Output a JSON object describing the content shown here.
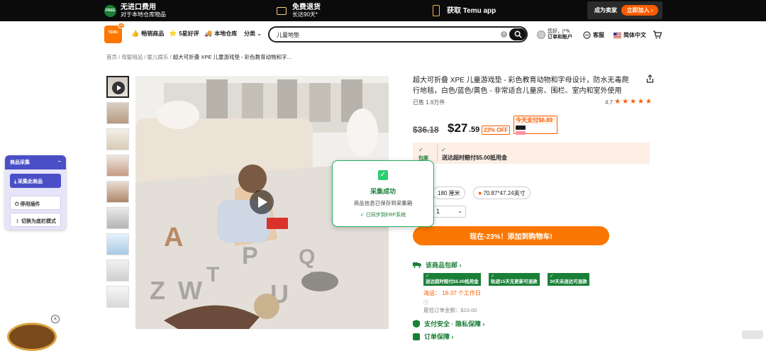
{
  "promo": {
    "free_badge": "FREE",
    "import_title": "无进口费用",
    "import_sub": "对于本地仓库物品",
    "ship_title": "免费退货",
    "ship_sub": "长达90天*",
    "app_label": "获取 Temu app",
    "seller_label": "成为卖家",
    "join_label": "立即加入 ›"
  },
  "header": {
    "logo_text": "TEMU",
    "logo_badge": "US",
    "nav": [
      {
        "icon": "👍",
        "label": "畅销商品"
      },
      {
        "icon": "⭐",
        "label": "5星好评"
      },
      {
        "icon": "🚚",
        "label": "本地仓库"
      },
      {
        "icon": "",
        "label": "分类 ⌄"
      }
    ],
    "search_value": "儿童地垫",
    "account_greeting": "您好，j**k",
    "account_label": "订单和账户",
    "service_label": "客服",
    "language_label": "简体中文"
  },
  "breadcrumb": {
    "items": [
      "首页",
      "母婴用品",
      "婴儿娱乐"
    ],
    "current": "超大可折叠 XPE 儿童游戏垫 - 彩色教育动物和字..."
  },
  "product": {
    "title": "超大可折叠 XPE 儿童游戏垫 - 彩色教育动物和字母设计，防水无毒爬行地毯，白色/蓝色/黄色 - 非常适合儿童房、围栏、室内和室外使用",
    "sold": "已售 1.9万件",
    "rating": "4.7",
    "original_price": "$36.18",
    "price_currency": "$",
    "price_main": "$27",
    "price_decimal": ".59",
    "off_badge": "23% OFF",
    "pay_today": "今天支付$6.89",
    "free_ship_short": "包邮",
    "credit_label": "送达超时赔付$5.00抵用金",
    "option_size": "180 厘米",
    "option_dim": "70.87*47.24英寸",
    "quantity": "1",
    "cart_button": "现在-23%！添加到购物车!",
    "ship_head": "该商品包邮 ›",
    "tags": [
      "送达超时赔付$5.00抵用金",
      "轨迹15天无更新可退款",
      "30天未送达可退款"
    ],
    "ship_days_label": "海运：",
    "ship_days_value": "18-37 个工作日",
    "min_amount": "最低订单金额：$10.00",
    "safe_head": "支付安全 · 隐私保障 ›",
    "order_head": "订单保障 ›"
  },
  "plugin": {
    "title": "商品采集",
    "collect": "采集此商品",
    "stop": "停用插件",
    "toggle": "切换为底栏模式"
  },
  "toast": {
    "title": "采集成功",
    "subtitle": "商品信息已保存到采集箱",
    "sync": "✓ 已同步到ERP系统"
  },
  "colors": {
    "accent": "#fb7701",
    "success": "#1a7f37",
    "plugin": "#4b4fc7"
  }
}
